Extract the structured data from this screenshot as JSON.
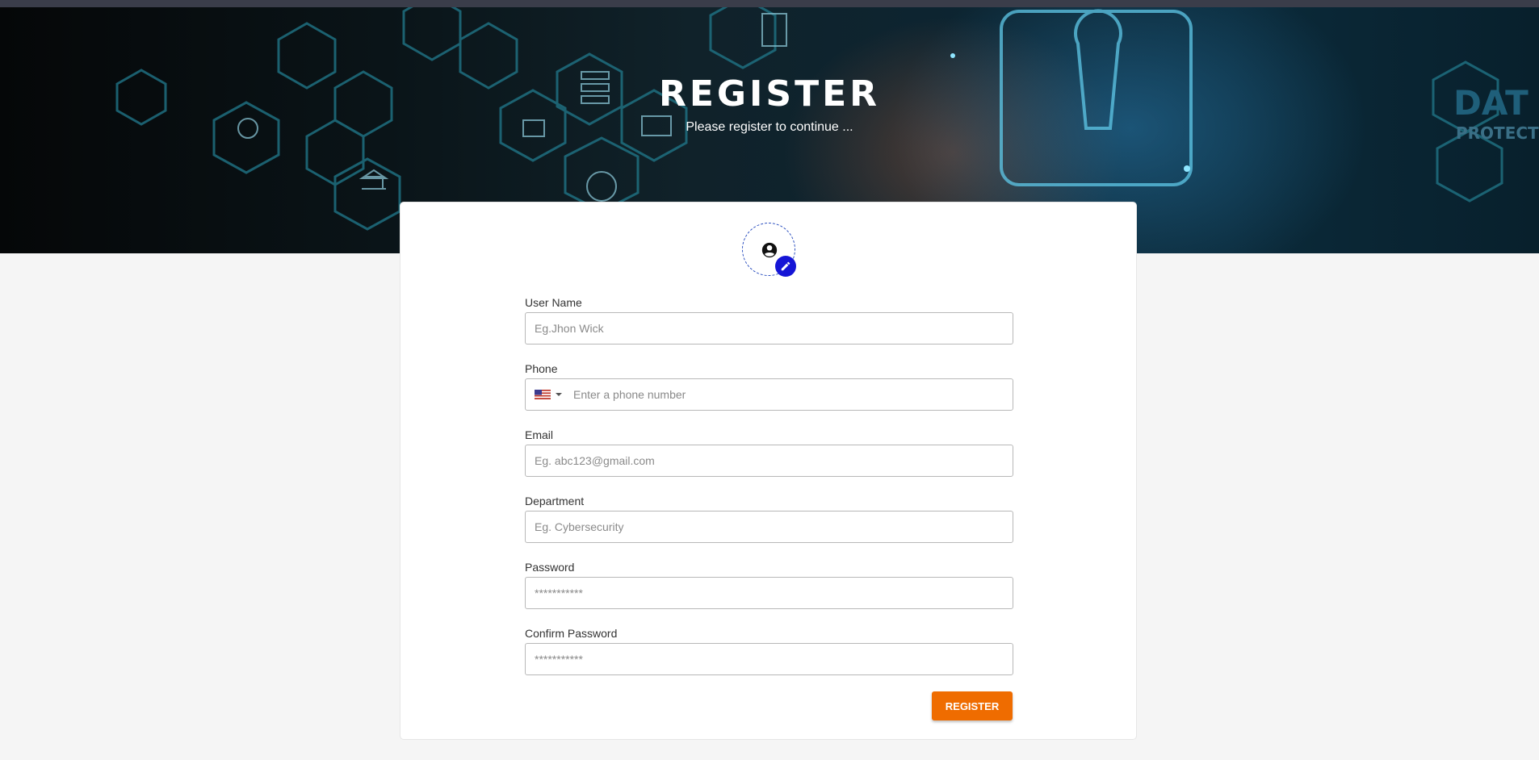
{
  "header": {
    "title": "REGISTER",
    "subtitle": "Please register to continue ...",
    "banner_text_1": "DAT",
    "banner_text_2": "PROTECT"
  },
  "form": {
    "avatar": {
      "icon": "account-circle-icon",
      "edit_icon": "pencil-icon"
    },
    "fields": [
      {
        "label": "User Name",
        "placeholder": "Eg.Jhon Wick",
        "value": ""
      },
      {
        "label": "Phone",
        "placeholder": "Enter a phone number",
        "value": "",
        "country": "US"
      },
      {
        "label": "Email",
        "placeholder": "Eg. abc123@gmail.com",
        "value": ""
      },
      {
        "label": "Department",
        "placeholder": "Eg. Cybersecurity",
        "value": ""
      },
      {
        "label": "Password",
        "placeholder": "***********",
        "value": ""
      },
      {
        "label": "Confirm Password",
        "placeholder": "***********",
        "value": ""
      }
    ],
    "submit_label": "REGISTER"
  },
  "colors": {
    "accent": "#ef6c00",
    "edit_badge": "#1515d6",
    "page_bg": "#f5f5f5"
  }
}
